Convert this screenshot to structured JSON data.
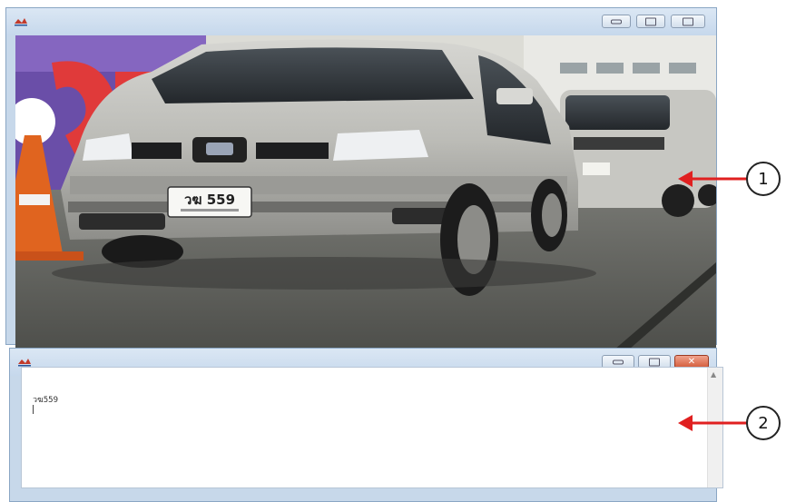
{
  "viewer_window": {
    "icon": "app-icon",
    "controls": [
      "minimize-icon",
      "maximize-icon",
      "close-icon"
    ],
    "plate": "วฆ 559"
  },
  "output_window": {
    "icon": "app-icon",
    "controls": [
      "minimize-icon",
      "maximize-icon",
      "close-icon"
    ],
    "recognized_text": "วฆ559"
  },
  "annotations": {
    "callout_1": "1",
    "callout_2": "2",
    "arrow_color": "#e02020"
  },
  "colors": {
    "titlebar": "#c6d8ec",
    "close_button": "#d35b3a"
  }
}
